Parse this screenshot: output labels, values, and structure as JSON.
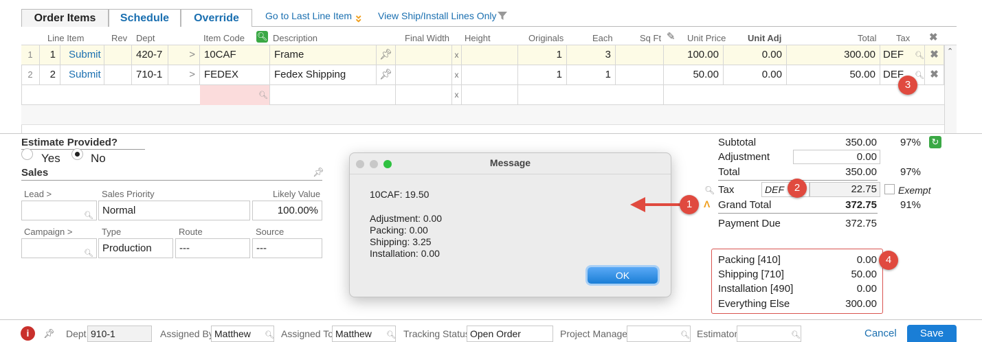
{
  "tabs": [
    "Order Items",
    "Schedule",
    "Override"
  ],
  "toplinks": {
    "last_line": "Go to Last Line Item",
    "view_ship": "View Ship/Install Lines Only"
  },
  "grid": {
    "headers": {
      "line_item": "Line Item",
      "rev": "Rev",
      "dept": "Dept",
      "item_code": "Item Code",
      "description": "Description",
      "final_width": "Final Width",
      "height": "Height",
      "originals": "Originals",
      "each": "Each",
      "sq_ft": "Sq Ft",
      "unit_price": "Unit Price",
      "unit_adj": "Unit Adj",
      "total": "Total",
      "tax": "Tax"
    },
    "rows": [
      {
        "idx": "1",
        "line": "1",
        "action": "Submit",
        "dept": "420-7",
        "arrow": ">",
        "item_code": "10CAF",
        "description": "Frame",
        "x": "x",
        "originals": "1",
        "each": "3",
        "unit_price": "100.00",
        "unit_adj": "0.00",
        "total": "300.00",
        "tax": "DEF"
      },
      {
        "idx": "2",
        "line": "2",
        "action": "Submit",
        "dept": "710-1",
        "arrow": ">",
        "item_code": "FEDEX",
        "description": "Fedex Shipping",
        "x": "x",
        "originals": "1",
        "each": "1",
        "unit_price": "50.00",
        "unit_adj": "0.00",
        "total": "50.00",
        "tax": "DEF"
      }
    ],
    "new_row_x": "x"
  },
  "estimate": {
    "title": "Estimate Provided?",
    "yes": "Yes",
    "no": "No"
  },
  "sales": {
    "title": "Sales",
    "lead_label": "Lead >",
    "priority_label": "Sales Priority",
    "priority_value": "Normal",
    "likely_label": "Likely Value",
    "likely_value": "100.00%",
    "campaign_label": "Campaign >",
    "type_label": "Type",
    "type_value": "Production",
    "route_label": "Route",
    "route_value": "---",
    "source_label": "Source",
    "source_value": "---"
  },
  "summary": {
    "subtotal_label": "Subtotal",
    "subtotal": "350.00",
    "subtotal_pct": "97%",
    "adjustment_label": "Adjustment",
    "adjustment": "0.00",
    "total_label": "Total",
    "total": "350.00",
    "total_pct": "97%",
    "tax_label": "Tax",
    "tax_code": "DEF",
    "tax": "22.75",
    "exempt": "Exempt",
    "grand_label": "Grand Total",
    "grand": "372.75",
    "grand_pct": "91%",
    "due_label": "Payment Due",
    "due": "372.75"
  },
  "breakdown": [
    {
      "label": "Packing [410]",
      "value": "0.00"
    },
    {
      "label": "Shipping [710]",
      "value": "50.00"
    },
    {
      "label": "Installation [490]",
      "value": "0.00"
    },
    {
      "label": "Everything Else",
      "value": "300.00"
    }
  ],
  "dialog": {
    "title": "Message",
    "line1": "10CAF: 19.50",
    "lines": [
      "Adjustment: 0.00",
      "Packing: 0.00",
      "Shipping: 3.25",
      "Installation: 0.00"
    ],
    "ok": "OK"
  },
  "badges": [
    "1",
    "2",
    "3",
    "4"
  ],
  "footer": {
    "dept_label": "Dept",
    "dept_value": "910-1",
    "assigned_by_label": "Assigned By",
    "assigned_by": "Matthew",
    "assigned_to_label": "Assigned To",
    "assigned_to": "Matthew",
    "tracking_label": "Tracking Status",
    "tracking": "Open Order",
    "pm_label": "Project Manager",
    "estimator_label": "Estimator",
    "cancel": "Cancel",
    "save": "Save"
  },
  "colors": {
    "accent": "#1a6fb0",
    "badge": "#e04a3f",
    "save_bg": "#1a7ed6",
    "row_hl": "#fdfbe6"
  }
}
